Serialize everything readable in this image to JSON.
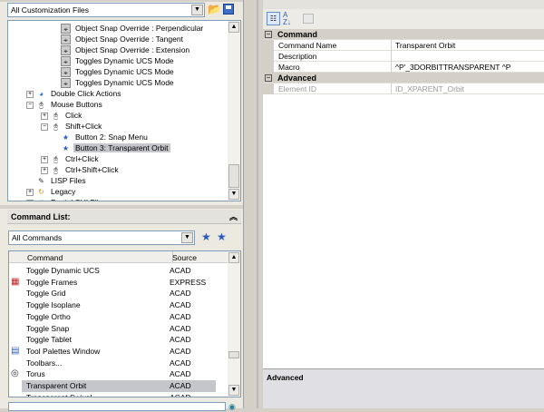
{
  "customization_files": {
    "selected": "All Customization Files",
    "tree": [
      {
        "label": "Object Snap Override : Perpendicular",
        "level": 3,
        "icon": "osnap-icon"
      },
      {
        "label": "Object Snap Override : Tangent",
        "level": 3,
        "icon": "osnap-icon"
      },
      {
        "label": "Object Snap Override : Extension",
        "level": 3,
        "icon": "osnap-icon"
      },
      {
        "label": "Toggles Dynamic UCS Mode",
        "level": 3,
        "icon": "osnap-icon"
      },
      {
        "label": "Toggles Dynamic UCS Mode",
        "level": 3,
        "icon": "osnap-icon"
      },
      {
        "label": "Toggles Dynamic UCS Mode",
        "level": 3,
        "icon": "osnap-icon"
      },
      {
        "label": "Double Click Actions",
        "level": 1,
        "icon": "double-click-icon",
        "expander": "+"
      },
      {
        "label": "Mouse Buttons",
        "level": 1,
        "icon": "mouse-icon",
        "expander": "-"
      },
      {
        "label": "Click",
        "level": 2,
        "icon": "mouse-icon",
        "expander": "+"
      },
      {
        "label": "Shift+Click",
        "level": 2,
        "icon": "mouse-icon",
        "expander": "-"
      },
      {
        "label": "Button 2: Snap Menu",
        "level": 3,
        "icon": "star-icon"
      },
      {
        "label": "Button 3: Transparent Orbit",
        "level": 3,
        "icon": "star-icon",
        "selected": true
      },
      {
        "label": "Ctrl+Click",
        "level": 2,
        "icon": "mouse-icon",
        "expander": "+"
      },
      {
        "label": "Ctrl+Shift+Click",
        "level": 2,
        "icon": "mouse-icon",
        "expander": "+"
      },
      {
        "label": "LISP Files",
        "level": 1,
        "icon": "lisp-icon"
      },
      {
        "label": "Legacy",
        "level": 1,
        "icon": "legacy-icon",
        "expander": "+"
      },
      {
        "label": "Partial CUI Files",
        "level": 1,
        "icon": "partial-cui-icon",
        "expander": "+"
      }
    ]
  },
  "command_list": {
    "title": "Command List:",
    "filter": "All Commands",
    "columns": [
      "Command",
      "Source"
    ],
    "rows": [
      {
        "command": "Toggle Dynamic UCS",
        "source": "ACAD",
        "icon": ""
      },
      {
        "command": "Toggle Frames",
        "source": "EXPRESS",
        "icon": "frames-icon"
      },
      {
        "command": "Toggle Grid",
        "source": "ACAD",
        "icon": ""
      },
      {
        "command": "Toggle Isoplane",
        "source": "ACAD",
        "icon": ""
      },
      {
        "command": "Toggle Ortho",
        "source": "ACAD",
        "icon": ""
      },
      {
        "command": "Toggle Snap",
        "source": "ACAD",
        "icon": ""
      },
      {
        "command": "Toggle Tablet",
        "source": "ACAD",
        "icon": ""
      },
      {
        "command": "Tool Palettes Window",
        "source": "ACAD",
        "icon": "tool-palettes-icon"
      },
      {
        "command": "Toolbars...",
        "source": "ACAD",
        "icon": ""
      },
      {
        "command": "Torus",
        "source": "ACAD",
        "icon": "torus-icon"
      },
      {
        "command": "Transparent Orbit",
        "source": "ACAD",
        "icon": "",
        "selected": true
      },
      {
        "command": "Transparent Swivel",
        "source": "ACAD",
        "icon": ""
      }
    ]
  },
  "properties": {
    "categories": [
      {
        "name": "Command",
        "rows": [
          {
            "name": "Command Name",
            "value": "Transparent Orbit"
          },
          {
            "name": "Description",
            "value": ""
          },
          {
            "name": "Macro",
            "value": "^P'_3DORBITTRANSPARENT ^P"
          }
        ]
      },
      {
        "name": "Advanced",
        "rows": [
          {
            "name": "Element ID",
            "value": "ID_XPARENT_Orbit",
            "disabled": true
          }
        ]
      }
    ],
    "description_title": "Advanced"
  }
}
